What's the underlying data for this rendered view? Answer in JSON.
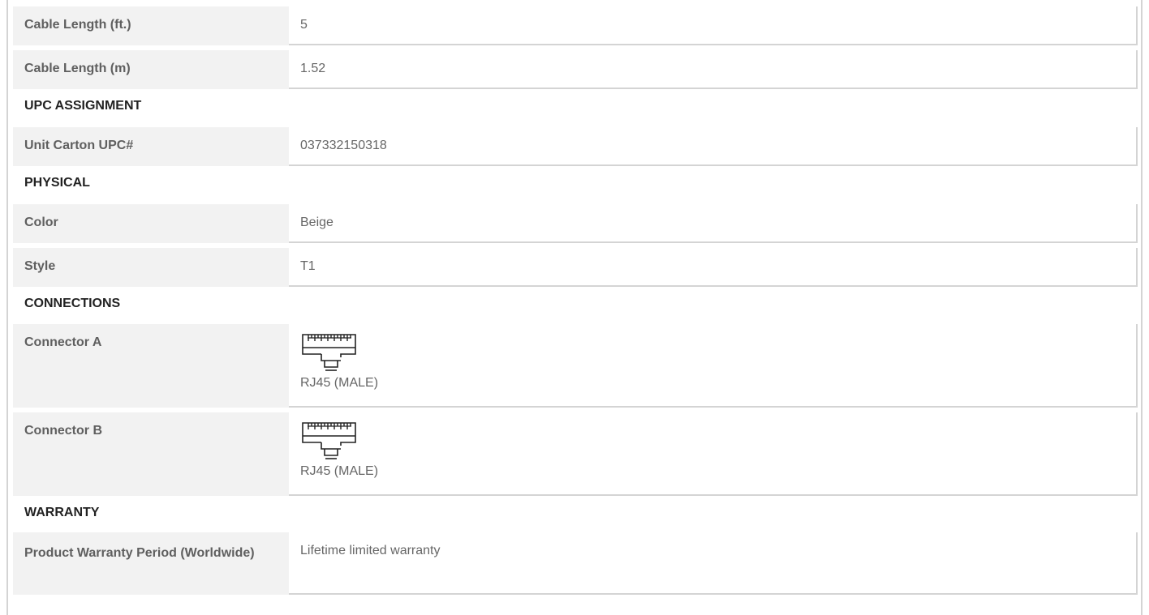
{
  "specs": {
    "cable_length_ft": {
      "label": "Cable Length (ft.)",
      "value": "5"
    },
    "cable_length_m": {
      "label": "Cable Length (m)",
      "value": "1.52"
    },
    "upc_section": "UPC ASSIGNMENT",
    "unit_carton_upc": {
      "label": "Unit Carton UPC#",
      "value": "037332150318"
    },
    "physical_section": "PHYSICAL",
    "color": {
      "label": "Color",
      "value": "Beige"
    },
    "style": {
      "label": "Style",
      "value": "T1"
    },
    "connections_section": "CONNECTIONS",
    "connector_a": {
      "label": "Connector A",
      "value": "RJ45 (MALE)",
      "icon": "rj45-connector-icon"
    },
    "connector_b": {
      "label": "Connector B",
      "value": "RJ45 (MALE)",
      "icon": "rj45-connector-icon"
    },
    "warranty_section": "WARRANTY",
    "warranty_period": {
      "label": "Product Warranty Period (Worldwide)",
      "value": "Lifetime limited warranty"
    }
  }
}
